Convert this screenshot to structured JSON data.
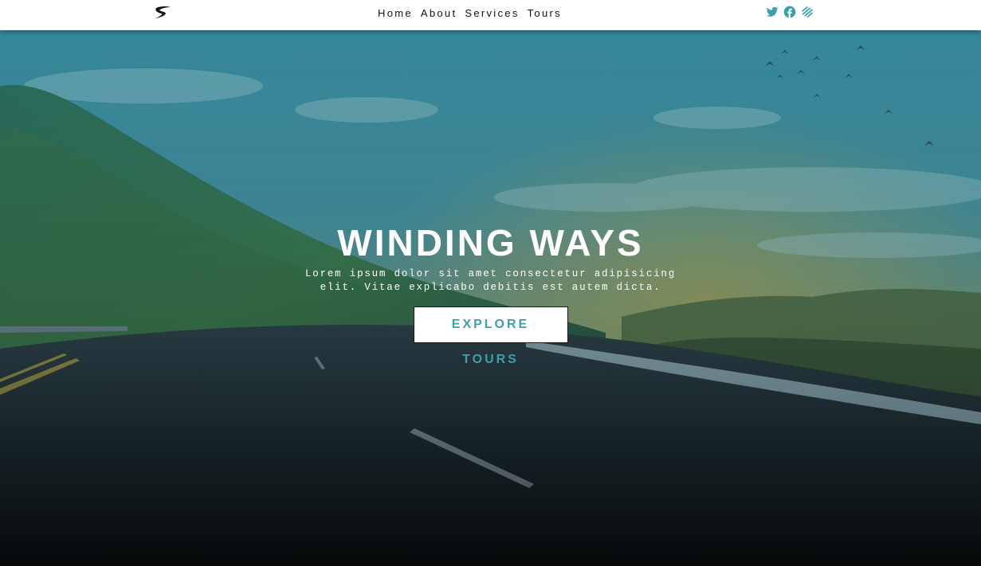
{
  "nav": {
    "logo": "logo-icon",
    "links": [
      "Home",
      "About",
      "Services",
      "Tours"
    ],
    "social_icons": [
      "twitter-icon",
      "facebook-icon",
      "squarespace-icon"
    ]
  },
  "hero": {
    "title": "WINDING WAYS",
    "text": "Lorem ipsum dolor sit amet consectetur adipisicing elit. Vitae explicabo debitis est autem dicta.",
    "button_label": "EXPLORE TOURS"
  },
  "colors": {
    "accent": "#3aa0b0",
    "navbar_bg": "#ffffff",
    "overlay": "#1f6f7f"
  }
}
